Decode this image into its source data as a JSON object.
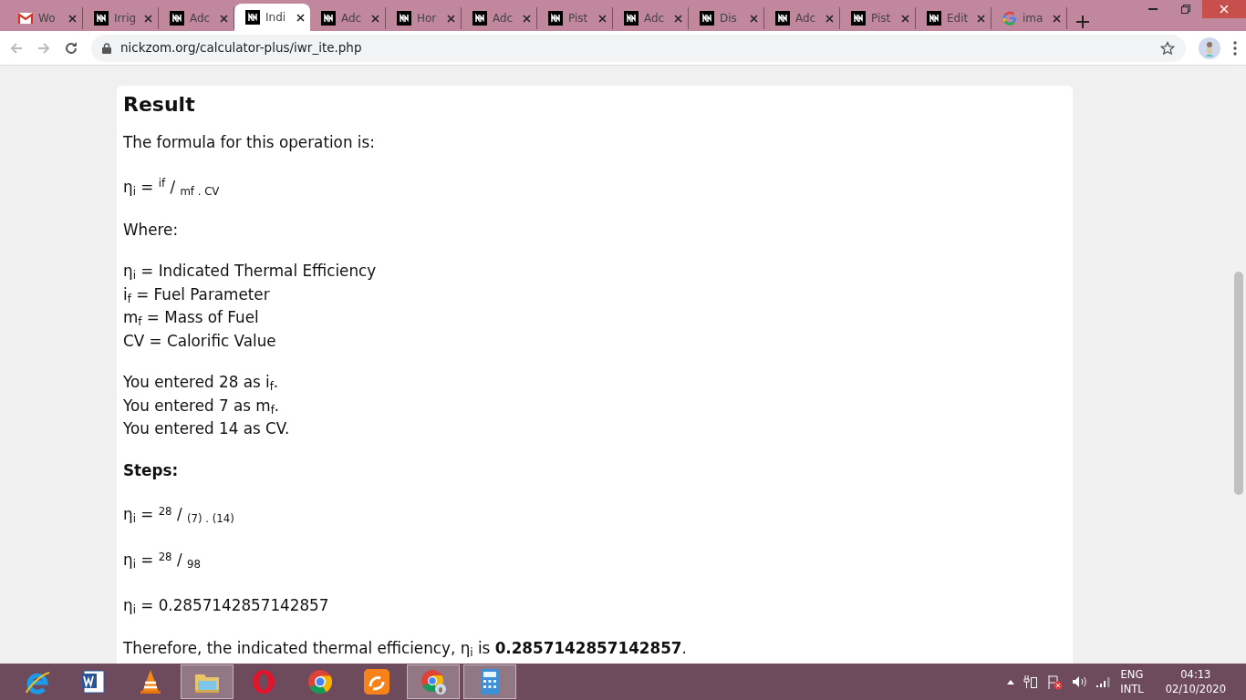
{
  "tabs": [
    {
      "label": "Wo",
      "kind": "gmail",
      "selected": false
    },
    {
      "label": "Irrig",
      "kind": "site",
      "selected": false
    },
    {
      "label": "Adc",
      "kind": "site",
      "selected": false
    },
    {
      "label": "Indi",
      "kind": "site",
      "selected": true
    },
    {
      "label": "Adc",
      "kind": "site",
      "selected": false
    },
    {
      "label": "Hor",
      "kind": "site",
      "selected": false
    },
    {
      "label": "Adc",
      "kind": "site",
      "selected": false
    },
    {
      "label": "Pist",
      "kind": "site",
      "selected": false
    },
    {
      "label": "Adc",
      "kind": "site",
      "selected": false
    },
    {
      "label": "Dis",
      "kind": "site",
      "selected": false
    },
    {
      "label": "Adc",
      "kind": "site",
      "selected": false
    },
    {
      "label": "Pist",
      "kind": "site",
      "selected": false
    },
    {
      "label": "Edit",
      "kind": "site",
      "selected": false
    },
    {
      "label": "ima",
      "kind": "google",
      "selected": false
    }
  ],
  "address": "nickzom.org/calculator-plus/iwr_ite.php",
  "result": {
    "title": "Result",
    "blocks": [
      {
        "kind": "text",
        "lines": [
          "The formula for this operation is:"
        ]
      },
      {
        "kind": "formula",
        "lines": [
          "η$_{i}$ = $^{if}$ / $_{mf . CV}$"
        ]
      },
      {
        "kind": "text",
        "lines": [
          "Where:"
        ]
      },
      {
        "kind": "text",
        "lines": [
          "η$_{i}$ = Indicated Thermal Efficiency",
          "i$_{f}$ = Fuel Parameter",
          "m$_{f}$ = Mass of Fuel",
          "CV = Calorific Value"
        ]
      },
      {
        "kind": "text",
        "lines": [
          "You entered 28 as i$_{f}$.",
          "You entered 7 as m$_{f}$.",
          "You entered 14 as CV."
        ]
      },
      {
        "kind": "bold",
        "lines": [
          "Steps:"
        ]
      },
      {
        "kind": "formula",
        "lines": [
          "η$_{i}$ = $^{28}$ / $_{(7) . (14)}$"
        ]
      },
      {
        "kind": "formula",
        "lines": [
          "η$_{i}$ = $^{28}$ / $_{98}$"
        ]
      },
      {
        "kind": "formula",
        "lines": [
          "η$_{i}$ = 0.2857142857142857"
        ]
      },
      {
        "kind": "text",
        "lines": [
          "Therefore, the indicated thermal efficiency, η$_{i}$ is **0.2857142857142857**."
        ]
      }
    ]
  },
  "taskbar": {
    "apps": [
      {
        "kind": "ie",
        "active": false
      },
      {
        "kind": "word",
        "active": false
      },
      {
        "kind": "vlc",
        "active": false
      },
      {
        "kind": "explorer",
        "active": true
      },
      {
        "kind": "opera",
        "active": false
      },
      {
        "kind": "chrome",
        "active": false
      },
      {
        "kind": "uc",
        "active": false
      },
      {
        "kind": "chrome-user",
        "active": true
      },
      {
        "kind": "calculator",
        "active": true
      }
    ],
    "language": "ENG",
    "layout": "INTL",
    "time": "04:13",
    "date": "02/10/2020"
  }
}
